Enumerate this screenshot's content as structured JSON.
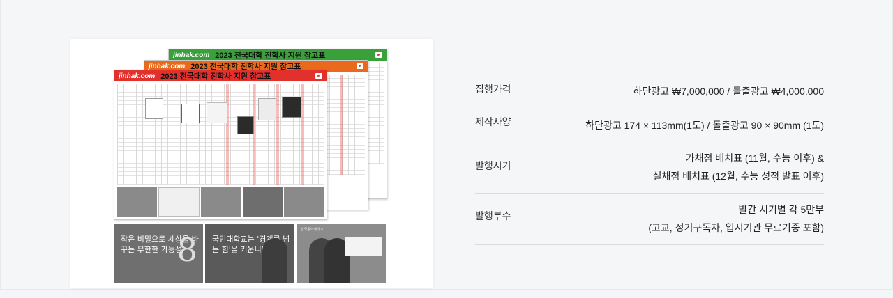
{
  "preview": {
    "brand": "jinhak.com",
    "sheet_title": "2023 전국대학 진학사 지원 참고표",
    "ads": {
      "ad1_text": "작은 비밀으로 세상을 바꾸는 무한한 가능성",
      "ad2_text": "국민대학교는 '경계를 넘는 힘'을 키웁니다",
      "ad3_text": "한국공학대학교"
    }
  },
  "specs": {
    "price": {
      "label": "집행가격",
      "value": "하단광고  ₩7,000,000 / 돌출광고  ₩4,000,000"
    },
    "size": {
      "label": "제작사양",
      "value": "하단광고  174 × 113mm(1도) / 돌출광고  90 × 90mm (1도)"
    },
    "timing": {
      "label": "발행시기",
      "line1": "가채점 배치표 (11월, 수능 이후) &",
      "line2": "실채점 배치표 (12월, 수능 성적 발표 이후)"
    },
    "copies": {
      "label": "발행부수",
      "line1": "발간 시기별 각 5만부",
      "line2": "(고교, 정기구독자, 입시기관 무료기증 포함)"
    }
  }
}
